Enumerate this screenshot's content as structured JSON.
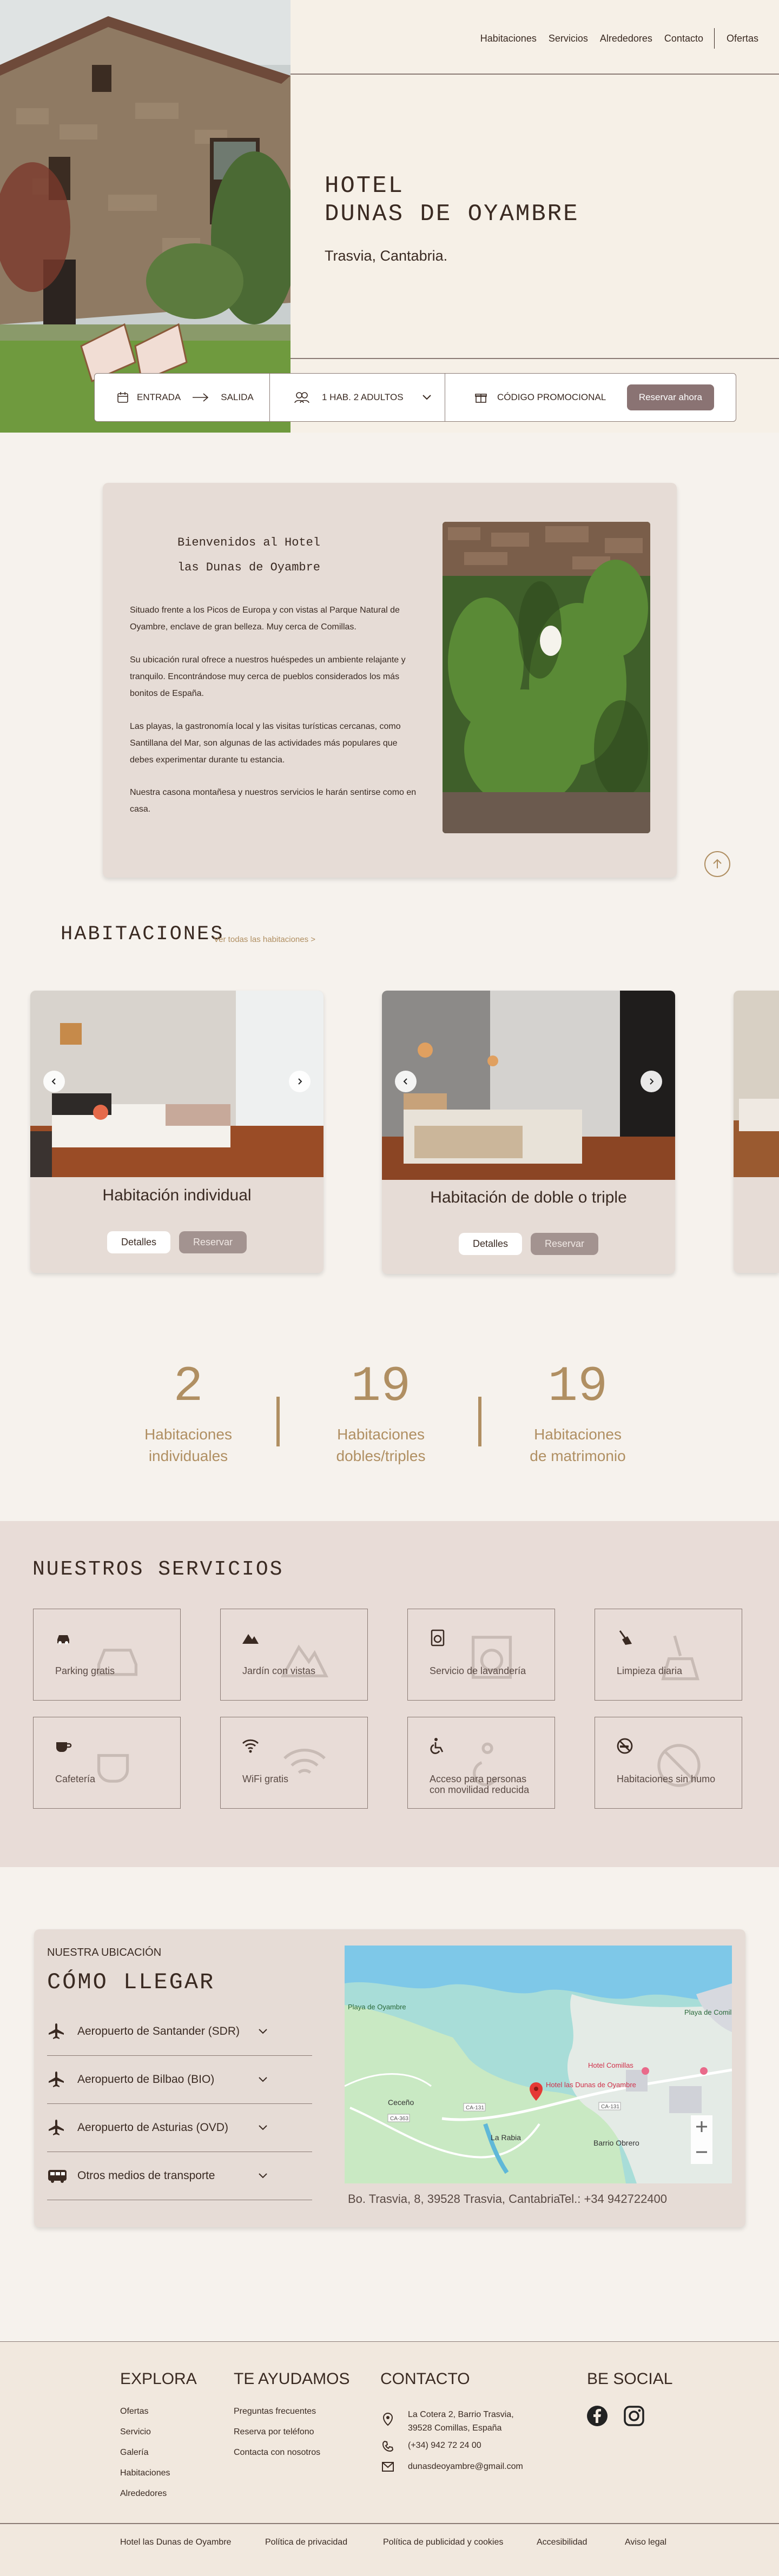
{
  "nav": {
    "items": [
      "Habitaciones",
      "Servicios",
      "Alrededores",
      "Contacto"
    ],
    "offers": "Ofertas"
  },
  "hero": {
    "title_line1": "HOTEL",
    "title_line2": "DUNAS DE OYAMBRE",
    "subtitle": "Trasvia, Cantabria."
  },
  "booking": {
    "checkin": "ENTRADA",
    "checkout": "SALIDA",
    "guests": "1 HAB. 2 ADULTOS",
    "promo": "CÓDIGO PROMOCIONAL",
    "reserve": "Reservar ahora"
  },
  "welcome": {
    "title_line1": "Bienvenidos al Hotel",
    "title_line2": "las Dunas de Oyambre",
    "paragraphs": [
      "Situado frente a los Picos de Europa y con vistas al Parque Natural de Oyambre, enclave de gran belleza. Muy cerca de Comillas.",
      "Su ubicación rural ofrece a nuestros huéspedes un ambiente relajante y tranquilo. Encontrándose muy cerca de pueblos considerados los más bonitos de España.",
      "Las playas, la gastronomía local y las visitas turísticas cercanas, como Santillana del Mar, son algunas de las actividades más populares que debes experimentar durante tu estancia.",
      "Nuestra casona montañesa y nuestros servicios le harán sentirse como en casa."
    ]
  },
  "rooms": {
    "title": "HABITACIONES",
    "see_all": "Ver todas las habitaciones >",
    "items": [
      {
        "name": "Habitación individual",
        "details": "Detalles",
        "reserve": "Reservar"
      },
      {
        "name": "Habitación de doble o triple",
        "details": "Detalles",
        "reserve": "Reservar"
      }
    ]
  },
  "stats": [
    {
      "number": "2",
      "label_line1": "Habitaciones",
      "label_line2": "individuales"
    },
    {
      "number": "19",
      "label_line1": "Habitaciones",
      "label_line2": "dobles/triples"
    },
    {
      "number": "19",
      "label_line1": "Habitaciones",
      "label_line2": "de matrimonio"
    }
  ],
  "services": {
    "title": "NUESTROS SERVICIOS",
    "items": [
      {
        "label": "Parking gratis",
        "icon": "car-icon"
      },
      {
        "label": "Jardín con vistas",
        "icon": "mountain-icon"
      },
      {
        "label": "Servicio de lavandería",
        "icon": "washing-machine-icon"
      },
      {
        "label": "Limpieza diaria",
        "icon": "broom-icon"
      },
      {
        "label": "Cafetería",
        "icon": "coffee-icon"
      },
      {
        "label": "WiFi gratis",
        "icon": "wifi-icon"
      },
      {
        "label": "Acceso para personas con movilidad reducida",
        "icon": "wheelchair-icon"
      },
      {
        "label": "Habitaciones sin humo",
        "icon": "no-smoking-icon"
      }
    ]
  },
  "location": {
    "kicker": "NUESTRA UBICACIÓN",
    "title": "CÓMO LLEGAR",
    "items": [
      {
        "label": "Aeropuerto de Santander (SDR)",
        "icon": "plane-icon"
      },
      {
        "label": "Aeropuerto de Bilbao (BIO)",
        "icon": "plane-icon"
      },
      {
        "label": "Aeropuerto de Asturias (OVD)",
        "icon": "plane-icon"
      },
      {
        "label": "Otros medios de transporte",
        "icon": "bus-icon"
      }
    ],
    "address": "Bo. Trasvia, 8, 39528 Trasvia, Cantabria",
    "phone": "Tel.: +34 942722400",
    "map": {
      "labels": {
        "playa_oyambre": "Playa de Oyambre",
        "playa_comillas": "Playa de Comillas",
        "hotel_comillas": "Hotel Comillas",
        "hotel_dunas": "Hotel las Dunas de Oyambre",
        "ceceno": "Ceceño",
        "la_rabia": "La Rabia",
        "barrio_obrero": "Barrio Obrero",
        "road1": "CA-131",
        "road2": "CA-363",
        "road3": "CA-131"
      }
    }
  },
  "footer": {
    "explore": {
      "title": "EXPLORA",
      "links": [
        "Ofertas",
        "Servicio",
        "Galería",
        "Habitaciones",
        "Alrededores"
      ]
    },
    "help": {
      "title": "TE AYUDAMOS",
      "links": [
        "Preguntas frecuentes",
        "Reserva por teléfono",
        "Contacta con nosotros"
      ]
    },
    "contact": {
      "title": "CONTACTO",
      "address_line1": "La Cotera 2, Barrio Trasvia,",
      "address_line2": "39528 Comillas, España",
      "phone": "(+34) 942 72 24 00",
      "email": "dunasdeoyambre@gmail.com"
    },
    "social": {
      "title": "BE SOCIAL"
    },
    "bottom": [
      "Hotel las Dunas de Oyambre",
      "Política de privacidad",
      "Política de publicidad y cookies",
      "Accesibilidad",
      "Aviso legal"
    ]
  },
  "colors": {
    "page_bg": "#f6f2ed",
    "card_bg": "#e6dcd6",
    "accent_gold": "#b08f62",
    "button_mauve": "#8a7373",
    "text_dark": "#3a2a22"
  }
}
